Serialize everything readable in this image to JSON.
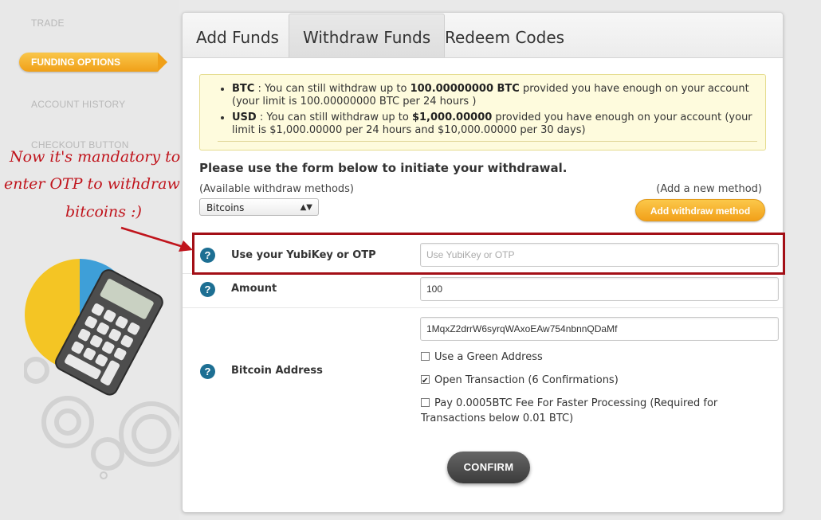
{
  "sidebar": {
    "items": [
      {
        "label": "TRADE",
        "active": false
      },
      {
        "label": "FUNDING OPTIONS",
        "active": true
      },
      {
        "label": "ACCOUNT HISTORY",
        "active": false
      },
      {
        "label": "CHECKOUT BUTTON",
        "active": false
      }
    ]
  },
  "tabs": [
    {
      "label": "Add Funds",
      "active": false
    },
    {
      "label": "Withdraw Funds",
      "active": true
    },
    {
      "label": "Redeem Codes",
      "active": false
    }
  ],
  "notice": {
    "btc": {
      "currency": "BTC",
      "text_before": " : You can still withdraw up to ",
      "amount": "100.00000000 BTC",
      "text_after": " provided you have enough on your account (your limit is 100.00000000 BTC per 24 hours )"
    },
    "usd": {
      "currency": "USD",
      "text_before": " : You can still withdraw up to ",
      "amount": "$1,000.00000",
      "text_after": " provided you have enough on your account (your limit is $1,000.00000 per 24 hours and $10,000.00000 per 30 days)"
    }
  },
  "form": {
    "title": "Please use the form below to initiate your withdrawal.",
    "methods_label": "(Available withdraw methods)",
    "method_selected": "Bitcoins",
    "add_method_label": "(Add a new method)",
    "add_method_button": "Add withdraw method",
    "otp": {
      "label": "Use your YubiKey or OTP",
      "placeholder": "Use YubiKey or OTP",
      "value": ""
    },
    "amount": {
      "label": "Amount",
      "value": "100"
    },
    "address": {
      "label": "Bitcoin Address",
      "value": "1MqxZ2drrW6syrqWAxoEAw754nbnnQDaMf"
    },
    "options": [
      {
        "label": "Use a Green Address",
        "checked": false
      },
      {
        "label": "Open Transaction (6 Confirmations)",
        "checked": true
      },
      {
        "label": "Pay 0.0005BTC Fee For Faster Processing (Required for Transactions below 0.01 BTC)",
        "checked": false
      }
    ],
    "confirm_button": "CONFIRM",
    "help_icon": "?"
  },
  "annotation": {
    "line1": "Now it's mandatory to",
    "line2": "enter OTP to withdraw",
    "line3": "bitcoins :)"
  },
  "colors": {
    "accent_orange": "#f2a019",
    "help_blue": "#1d6f93",
    "annotation_red": "#c0141c",
    "notice_bg": "#fefbdd"
  }
}
